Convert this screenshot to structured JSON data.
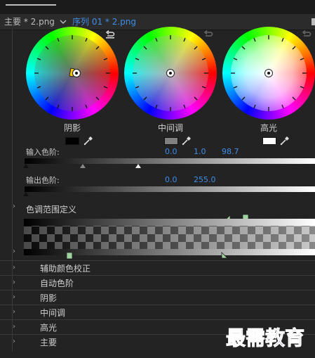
{
  "tabs": {
    "source_label": "主要 * 2.png",
    "sequence_label": "序列 01 * 2.png"
  },
  "wheels": [
    {
      "label": "阴影"
    },
    {
      "label": "中间调"
    },
    {
      "label": "高光"
    }
  ],
  "swatch_colors": {
    "shadow": "#000000",
    "midtone": "#808080",
    "highlight": "#ffffff"
  },
  "input_levels": {
    "label": "输入色阶:",
    "black": "0.0",
    "gamma": "1.0",
    "white": "98.7"
  },
  "output_levels": {
    "label": "输出色阶:",
    "black": "0.0",
    "white": "255.0"
  },
  "tonal_range": {
    "label": "色调范围定义"
  },
  "sections": [
    {
      "label": "辅助颜色校正"
    },
    {
      "label": "自动色阶"
    },
    {
      "label": "阴影"
    },
    {
      "label": "中间调"
    },
    {
      "label": "高光"
    },
    {
      "label": "主要"
    }
  ],
  "watermark": "最需教育",
  "accent_color": "#3d8ee8"
}
